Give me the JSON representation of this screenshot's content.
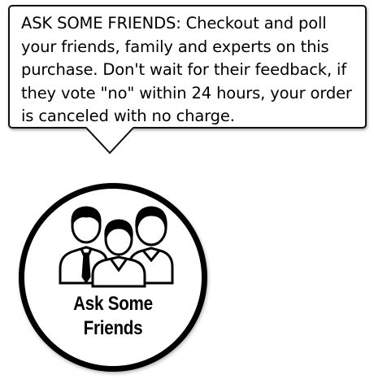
{
  "tooltip": {
    "text": "ASK SOME FRIENDS: Checkout and poll your friends, family and experts on this purchase. Don't wait for their feedback, if they vote \"no\" within 24 hours, your order is canceled with no charge."
  },
  "badge": {
    "label_line1": "Ask Some",
    "label_line2": "Friends",
    "icon": "group-of-people-icon"
  }
}
